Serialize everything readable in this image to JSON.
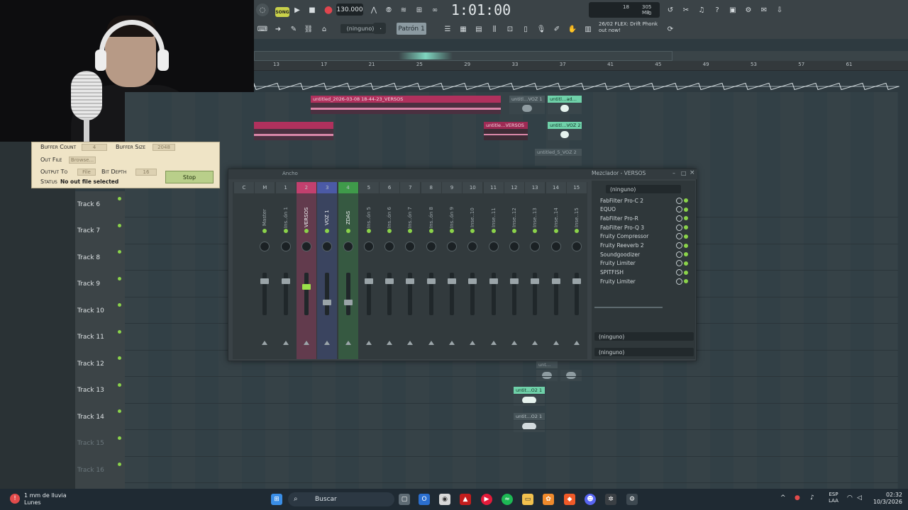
{
  "toolbar": {
    "song_label": "SONG",
    "tempo": "130.000",
    "time": "1:01:00",
    "cpu_value": "18",
    "mem_value": "305 MB",
    "mem_zero": "0",
    "pattern_name": "Patrón 1",
    "pattern_select": "(ninguno)",
    "news_line1": "26/02 FLEX: Drift Phonk",
    "news_line2": "out now!"
  },
  "ruler": [
    "13",
    "17",
    "21",
    "25",
    "29",
    "33",
    "37",
    "41",
    "45",
    "49",
    "53",
    "57",
    "61"
  ],
  "playlist": {
    "clips": {
      "main": "untitled_2026-03-08 18-44-23_VERSOS",
      "versos_short": "untitle…VERSOS",
      "voz2": "untitl…VOZ 1",
      "adlib1": "untitl…ad…",
      "adlib2": "untitl…VOZ 2",
      "vz5": "untitled_5_VOZ 2",
      "o2a": "untit…O2 1",
      "o2b": "untit…O2 1",
      "unt": "unt…"
    },
    "tracks": [
      {
        "label": "Track 6",
        "dim": false
      },
      {
        "label": "Track 7",
        "dim": false
      },
      {
        "label": "Track 8",
        "dim": false
      },
      {
        "label": "Track 9",
        "dim": false
      },
      {
        "label": "Track 10",
        "dim": false
      },
      {
        "label": "Track 11",
        "dim": false
      },
      {
        "label": "Track 12",
        "dim": false
      },
      {
        "label": "Track 13",
        "dim": false
      },
      {
        "label": "Track 14",
        "dim": false
      },
      {
        "label": "Track 15",
        "dim": true
      },
      {
        "label": "Track 16",
        "dim": true
      }
    ]
  },
  "recorder": {
    "buffer_count_label": "Buffer Count",
    "buffer_count_value": "4",
    "buffer_size_label": "Buffer Size",
    "buffer_size_value": "2048",
    "out_file_label": "Out File",
    "browse_label": "Browse...",
    "output_to_label": "Output To",
    "output_to_value": "File",
    "bit_depth_label": "Bit Depth",
    "bit_depth_value": "16",
    "status_label": "Status",
    "status_value": "No out file selected",
    "stop_label": "Stop"
  },
  "mixer": {
    "title": "Mezclador - VERSOS",
    "view_label": "Ancho",
    "channels": [
      {
        "num": "C",
        "name": "",
        "color": "none"
      },
      {
        "num": "M",
        "name": "Master",
        "color": "none"
      },
      {
        "num": "1",
        "name": "Ins..ón 1",
        "color": "none"
      },
      {
        "num": "2",
        "name": "VERSOS",
        "color": "#c2406e"
      },
      {
        "num": "3",
        "name": "VOZ 1",
        "color": "#4b5aa6"
      },
      {
        "num": "4",
        "name": "ZDAS",
        "color": "#3f9a4a"
      },
      {
        "num": "5",
        "name": "Ins..ón 5",
        "color": "none"
      },
      {
        "num": "6",
        "name": "Ins..ón 6",
        "color": "none"
      },
      {
        "num": "7",
        "name": "Ins..ón 7",
        "color": "none"
      },
      {
        "num": "8",
        "name": "Ins..ón 8",
        "color": "none"
      },
      {
        "num": "9",
        "name": "Ins..ón 9",
        "color": "none"
      },
      {
        "num": "10",
        "name": "Inse..10",
        "color": "none"
      },
      {
        "num": "11",
        "name": "Inse..11",
        "color": "none"
      },
      {
        "num": "12",
        "name": "Inse..12",
        "color": "none"
      },
      {
        "num": "13",
        "name": "Inse..13",
        "color": "none"
      },
      {
        "num": "14",
        "name": "Inse..14",
        "color": "none"
      },
      {
        "num": "15",
        "name": "Inse..15",
        "color": "none"
      }
    ],
    "input_select": "(ninguno)",
    "fx_slots": [
      "FabFilter Pro-C 2",
      "EQUO",
      "FabFilter Pro-R",
      "FabFilter Pro-Q 3",
      "Fruity Compressor",
      "Fruity Reeverb 2",
      "Soundgoodizer",
      "Fruity Limiter",
      "SPITFISH",
      "Fruity Limiter"
    ],
    "output_select_1": "(ninguno)",
    "output_select_2": "(ninguno)"
  },
  "taskbar": {
    "weather_line1": "1 mm de lluvia",
    "weather_line2": "Lunes",
    "search_placeholder": "Buscar",
    "lang_line1": "ESP",
    "lang_line2": "LAA",
    "clock_time": "02:32",
    "clock_date": "10/3/2026"
  }
}
